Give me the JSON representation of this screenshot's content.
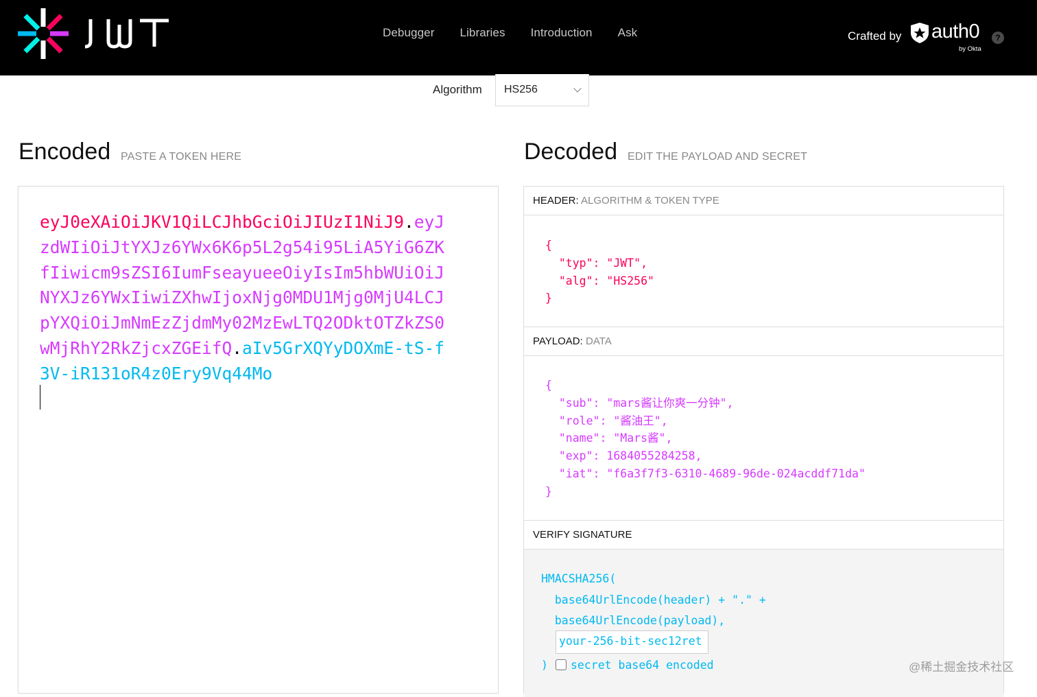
{
  "header": {
    "brand": "JWT",
    "nav": [
      "Debugger",
      "Libraries",
      "Introduction",
      "Ask"
    ],
    "crafted_by": "Crafted by",
    "auth0_name": "auth0",
    "auth0_sub": "by Okta",
    "help_symbol": "?"
  },
  "algorithm": {
    "label": "Algorithm",
    "selected": "HS256"
  },
  "encoded": {
    "title": "Encoded",
    "subtitle": "PASTE A TOKEN HERE",
    "token_header": "eyJ0eXAiOiJKV1QiLCJhbGciOiJIUzI1NiJ9",
    "token_payload": "eyJzdWIiOiJtYXJz6YWx6K6p5L2g54i95LiA5YiG6ZKfIiwicm9sZSI6IumFseayueeOiyIsIm5hbWUiOiJNYXJz6YWxIiwiZXhwIjoxNjg0MDU1Mjg0MjU4LCJpYXQiOiJmNmEzZjdmMy02MzEwLTQ2ODktOTZkZS0wMjRhY2RkZjcxZGEifQ",
    "token_signature": "aIv5GrXQYyDOXmE-tS-f3V-iR131oR4z0Ery9Vq44Mo",
    "dot1": ".",
    "dot2": "."
  },
  "decoded": {
    "title": "Decoded",
    "subtitle": "EDIT THE PAYLOAD AND SECRET",
    "header_section": {
      "label": "HEADER:",
      "muted": "ALGORITHM & TOKEN TYPE"
    },
    "header_lines": [
      "{",
      "  \"typ\": \"JWT\",",
      "  \"alg\": \"HS256\"",
      "}"
    ],
    "payload_section": {
      "label": "PAYLOAD:",
      "muted": "DATA"
    },
    "payload_lines": [
      "{",
      "  \"sub\": \"mars酱让你爽一分钟\",",
      "  \"role\": \"酱油王\",",
      "  \"name\": \"Mars酱\",",
      "  \"exp\": 1684055284258,",
      "  \"iat\": \"f6a3f7f3-6310-4689-96de-024acddf71da\"",
      "}"
    ],
    "verify_section": {
      "label": "VERIFY SIGNATURE"
    },
    "verify_lines": [
      "HMACSHA256(",
      "  base64UrlEncode(header) + \".\" +",
      "  base64UrlEncode(payload),"
    ],
    "secret_value": "your-256-bit-sec12ret",
    "close_paren": ")",
    "base64_label": "secret base64 encoded"
  },
  "watermark": "@稀土掘金技术社区"
}
